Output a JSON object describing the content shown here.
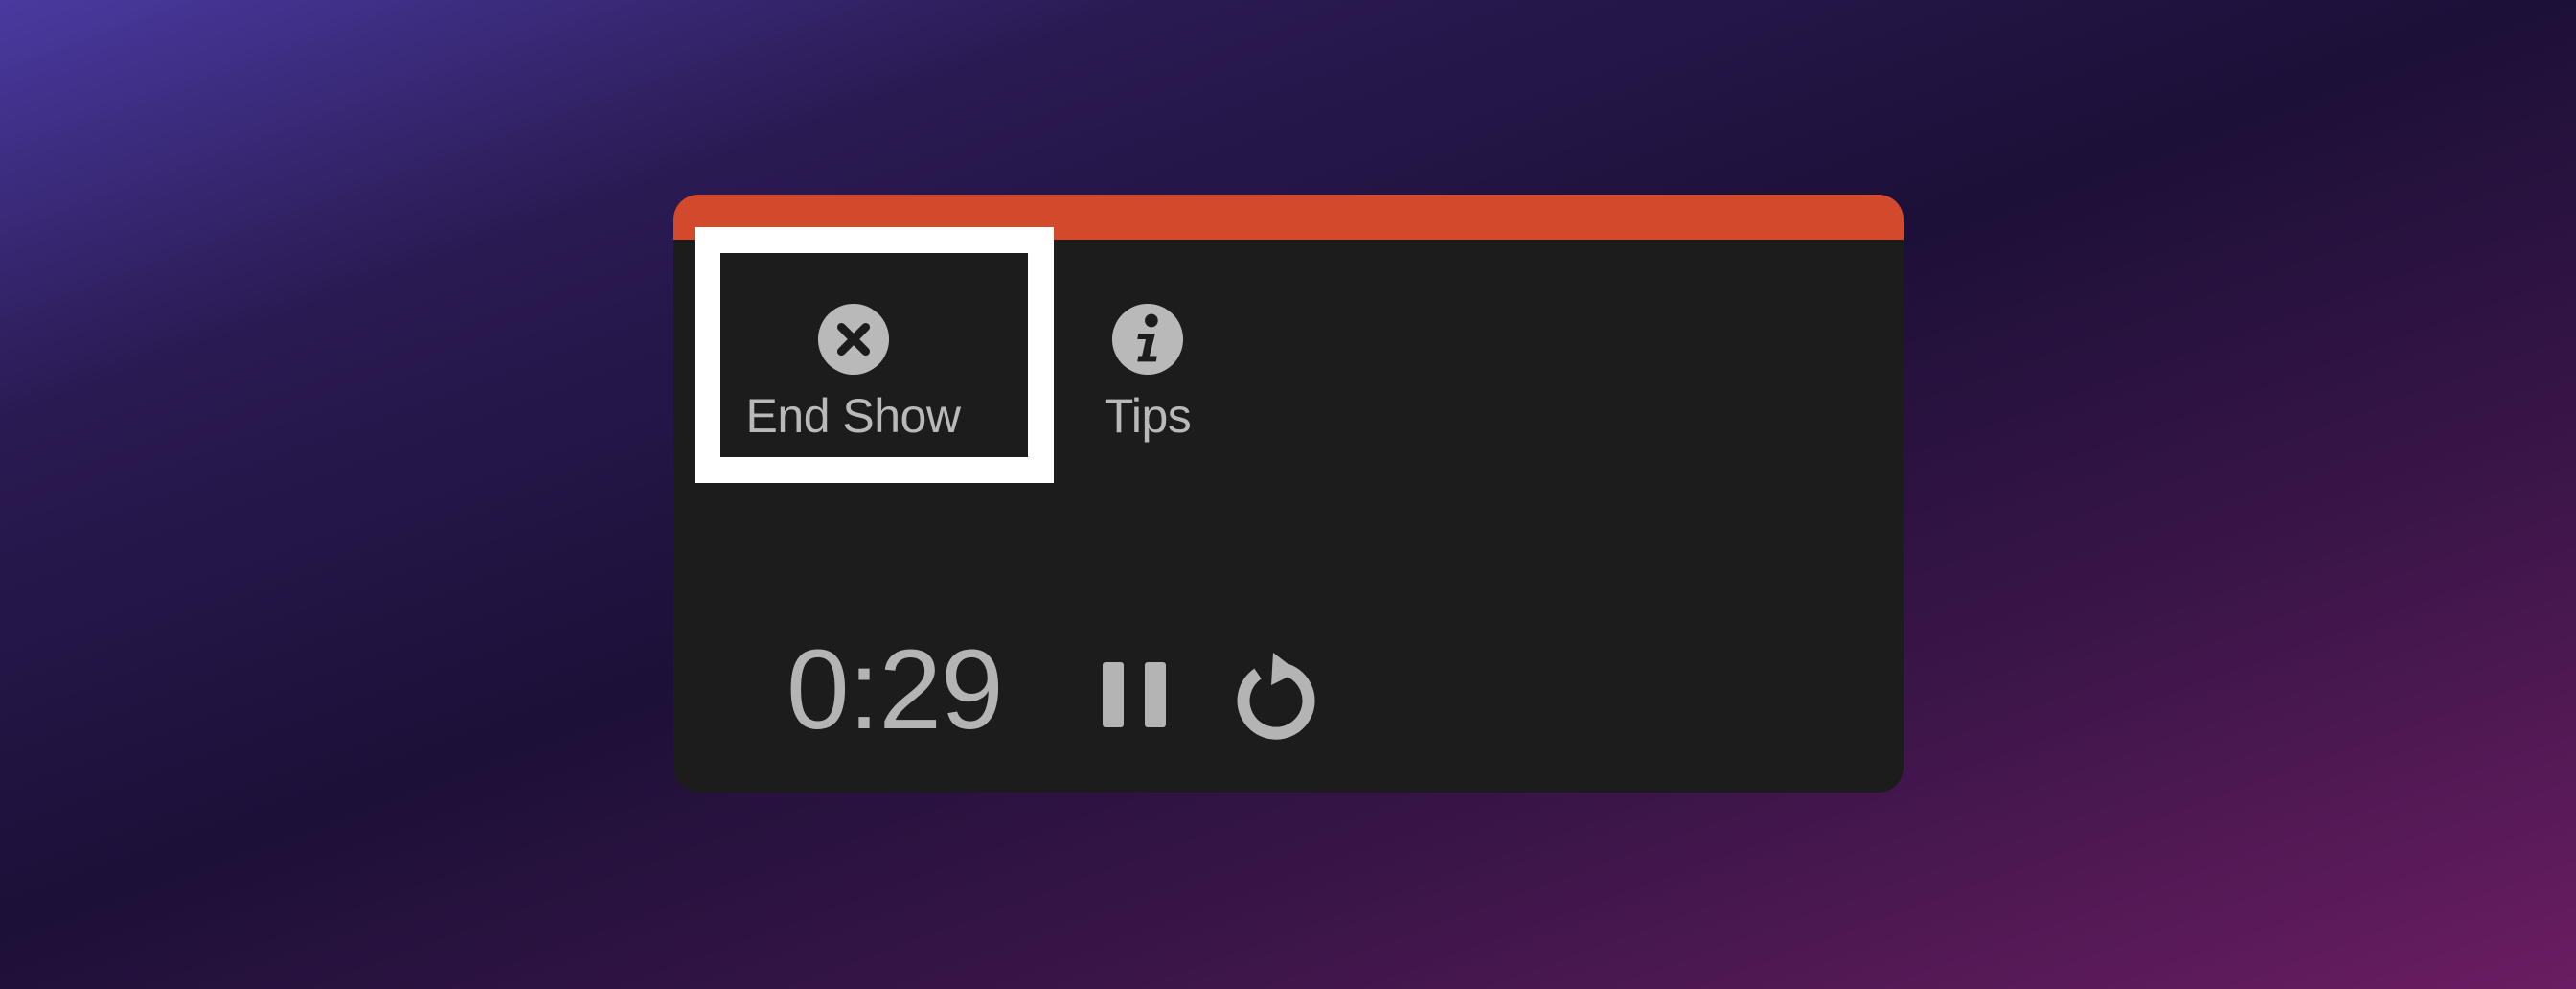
{
  "toolbar": {
    "end_show": {
      "label": "End Show",
      "icon": "close-circle-icon"
    },
    "tips": {
      "label": "Tips",
      "icon": "info-circle-icon"
    }
  },
  "timer": {
    "elapsed": "0:29"
  },
  "controls": {
    "pause": {
      "icon": "pause-icon"
    },
    "restart": {
      "icon": "restart-icon"
    }
  },
  "colors": {
    "accent_bar": "#d2492c",
    "panel_bg": "#1c1c1c",
    "text": "#b9b9b9",
    "highlight": "#ffffff"
  }
}
